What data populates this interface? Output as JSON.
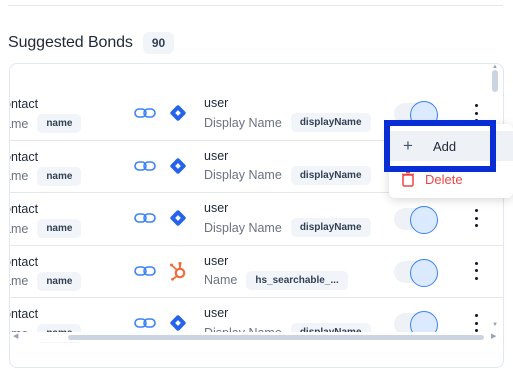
{
  "section": {
    "title": "Suggested Bonds",
    "count": "90"
  },
  "rows": [
    {
      "source_title": "ontact",
      "source_label": "ame",
      "source_chip": "name",
      "target_icon": "jira-diamond-icon",
      "target_title": "user",
      "target_label": "Display Name",
      "target_chip": "displayName"
    },
    {
      "source_title": "ontact",
      "source_label": "ame",
      "source_chip": "name",
      "target_icon": "jira-diamond-icon",
      "target_title": "user",
      "target_label": "Display Name",
      "target_chip": "displayName"
    },
    {
      "source_title": "ontact",
      "source_label": "ame",
      "source_chip": "name",
      "target_icon": "jira-diamond-icon",
      "target_title": "user",
      "target_label": "Display Name",
      "target_chip": "displayName"
    },
    {
      "source_title": "ontact",
      "source_label": "ame",
      "source_chip": "name",
      "target_icon": "hubspot-sprocket-icon",
      "target_title": "user",
      "target_label": "Name",
      "target_chip": "hs_searchable_..."
    },
    {
      "source_title": "ontact",
      "source_label": "ame",
      "source_chip": "name",
      "target_icon": "jira-diamond-icon",
      "target_title": "user",
      "target_label": "Display Name",
      "target_chip": "displayName"
    }
  ],
  "context_menu": {
    "add_label": "Add",
    "delete_label": "Delete"
  },
  "colors": {
    "accent": "#2563eb",
    "highlight": "#0a2ed6",
    "delete": "#ef4444",
    "hubspot": "#f26b3a"
  }
}
